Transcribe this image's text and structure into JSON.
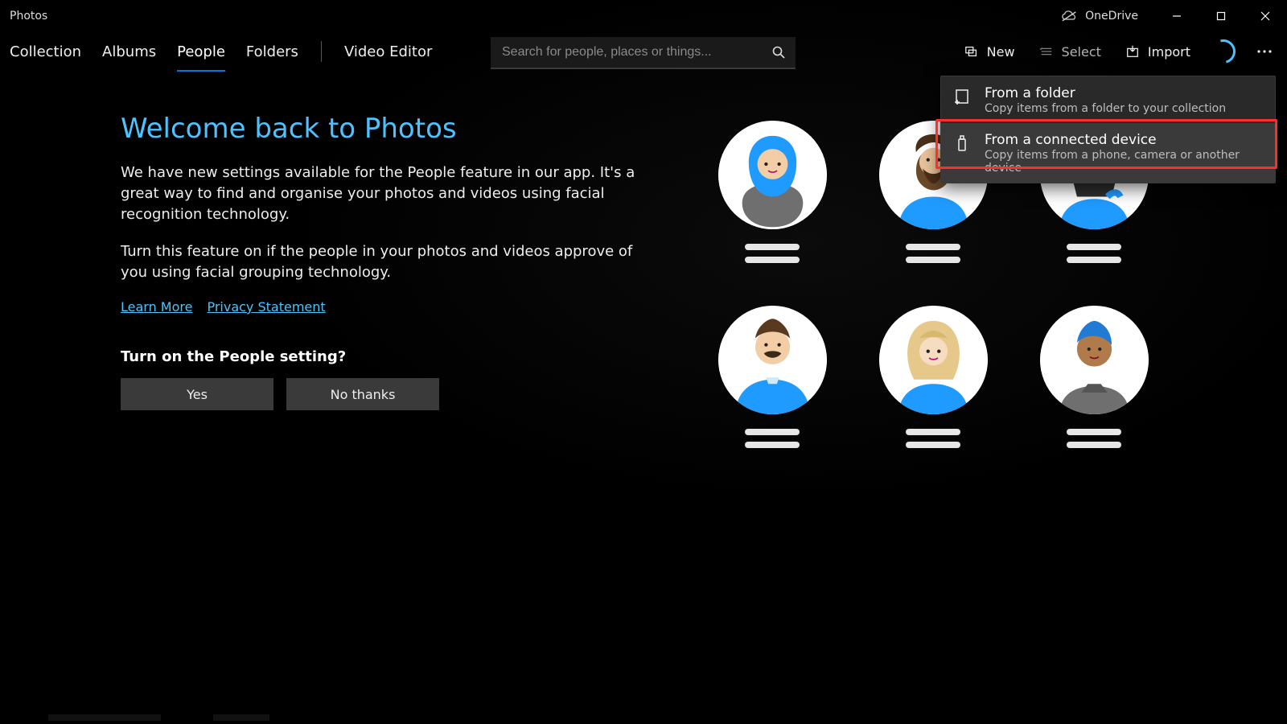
{
  "app_title": "Photos",
  "titlebar": {
    "onedrive": "OneDrive"
  },
  "tabs": {
    "collection": "Collection",
    "albums": "Albums",
    "people": "People",
    "folders": "Folders",
    "video_editor": "Video Editor",
    "active": "people"
  },
  "search": {
    "placeholder": "Search for people, places or things..."
  },
  "actions": {
    "new": "New",
    "select": "Select",
    "import": "Import"
  },
  "import_menu": {
    "folder": {
      "title": "From a folder",
      "subtitle": "Copy items from a folder to your collection"
    },
    "device": {
      "title": "From a connected device",
      "subtitle": "Copy items from a phone, camera or another device"
    },
    "highlighted": "device"
  },
  "content": {
    "headline": "Welcome back to Photos",
    "para1": "We have new settings available for the People feature in our app. It's a great way to find and organise your photos and videos using facial recognition technology.",
    "para2": "Turn this feature on if the people in your photos and videos approve of you using facial grouping technology.",
    "learn_more": "Learn More",
    "privacy": "Privacy Statement",
    "prompt": "Turn on the People setting?",
    "yes": "Yes",
    "no": "No thanks"
  },
  "colors": {
    "accent": "#4cc2ff",
    "blue": "#0078d4"
  }
}
